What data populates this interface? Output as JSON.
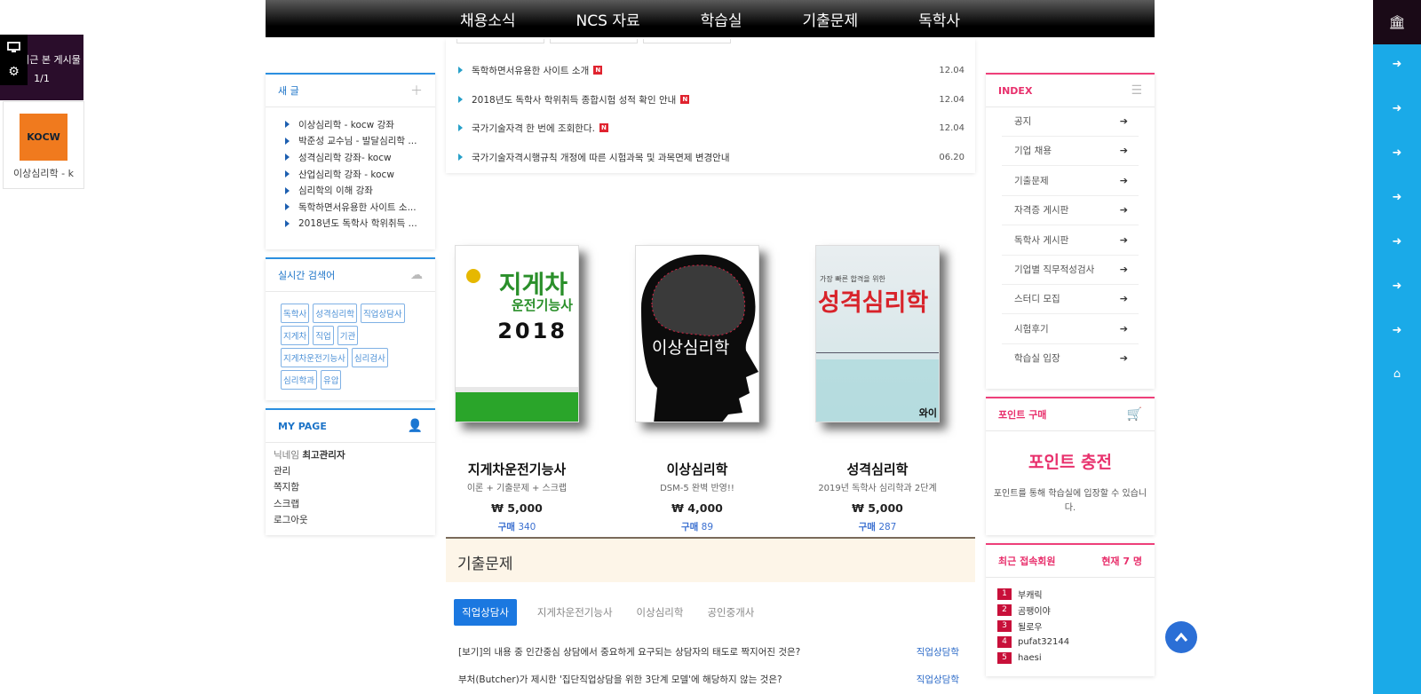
{
  "nav": {
    "items": [
      "채용소식",
      "NCS 자료",
      "학습실",
      "기출문제",
      "독학사"
    ]
  },
  "left_panel": {
    "title": "최근 본 게시물",
    "title_visible": "본 게시물",
    "counter": "1/1",
    "thumb_label": "KOCW",
    "caption": "이상심리학 - k"
  },
  "new_posts": {
    "title": "새 글",
    "items": [
      "이상심리학 - kocw 강좌",
      "박준성 교수님 - 발달심리학 ...",
      "성격심리학 강좌- kocw",
      "산업심리학 강좌 - kocw",
      "심리학의 이해 강좌",
      "독학하면서유용한 사이트 소...",
      "2018년도 독학사 학위취득 ..."
    ]
  },
  "realtime": {
    "title": "실시간 검색어",
    "tags": [
      "독학사",
      "성격심리학",
      "직업상담사",
      "지게차",
      "직업",
      "기관",
      "지게차운전기능사",
      "심리검사",
      "심리학과",
      "유압"
    ]
  },
  "mypage": {
    "title": "MY PAGE",
    "nick_label": "닉네임",
    "nick_value": "최고관리자",
    "links": [
      "관리",
      "쪽지함",
      "스크랩",
      "로그아웃"
    ]
  },
  "notices": [
    {
      "title": "독학하면서유용한 사이트 소개",
      "badge": "N",
      "date": "12.04"
    },
    {
      "title": "2018년도 독학사 학위취득 종합시험 성적 확인 안내",
      "badge": "N",
      "date": "12.04"
    },
    {
      "title": "국가기술자격 한 번에 조회한다.",
      "badge": "N",
      "date": "12.04"
    },
    {
      "title": "국가기술자격시행규칙 개정에 따른 시험과목 및 과목면제 변경안내",
      "badge": "",
      "date": "06.20"
    }
  ],
  "books": [
    {
      "title": "지게차운전기능사",
      "sub": "이론 + 기출문제 + 스크랩",
      "price": "₩ 5,000",
      "buy": "구매",
      "count": "340",
      "cover_main": "지게차",
      "cover_sub": "운전기능사",
      "cover_year": "2018"
    },
    {
      "title": "이상심리학",
      "sub": "DSM-5 완벽 반영!!",
      "price": "₩ 4,000",
      "buy": "구매",
      "count": "89",
      "cover_main": "이상심리학"
    },
    {
      "title": "성격심리학",
      "sub": "2019년 독학사 심리학과 2단계",
      "price": "₩ 5,000",
      "buy": "구매",
      "count": "287",
      "cover_top": "가장 빠른 합격을 위한",
      "cover_main": "성격심리학",
      "cover_foot": "와이"
    }
  ],
  "exam": {
    "title": "기출문제",
    "tabs": [
      "직업상담사",
      "지게차운전기능사",
      "이상심리학",
      "공인중개사"
    ],
    "active_tab": 0,
    "rows": [
      {
        "q": "[보기]의 내용 중 인간중심 상담에서 중요하게 요구되는 상담자의 태도로 짝지어진 것은?",
        "cat": "직업상담학"
      },
      {
        "q": "부처(Butcher)가 제시한 '집단직업상담을 위한 3단계 모델'에 해당하지 않는 것은?",
        "cat": "직업상담학"
      }
    ]
  },
  "index": {
    "title": "INDEX",
    "items": [
      "공지",
      "기업 채용",
      "기출문제",
      "자격증 게시판",
      "독학사 게시판",
      "기업별 직무적성검사",
      "스터디 모집",
      "시험후기",
      "학습실 입장"
    ]
  },
  "points": {
    "title": "포인트 구매",
    "headline": "포인트 충전",
    "desc": "포인트를 통해 학습실에 입장할 수 있습니다."
  },
  "recent_users": {
    "title": "최근 접속회원",
    "count": "현재 7 명",
    "users": [
      {
        "n": "1",
        "name": "부캐릭"
      },
      {
        "n": "2",
        "name": "곰팽이야"
      },
      {
        "n": "3",
        "name": "될로우"
      },
      {
        "n": "4",
        "name": "pufat32144"
      },
      {
        "n": "5",
        "name": "haesi"
      }
    ]
  },
  "colors": {
    "accent": "#2b8fe0",
    "pink": "#e8306c",
    "rightbar": "#1aaae8"
  }
}
